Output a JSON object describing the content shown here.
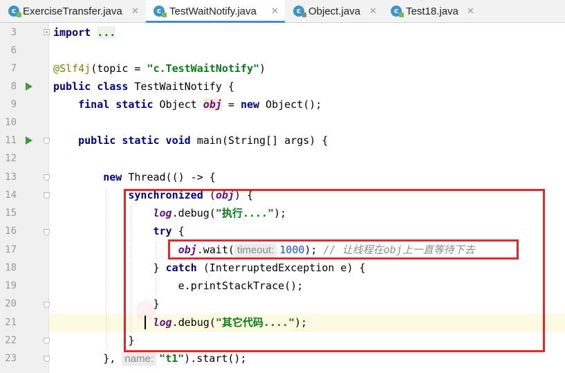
{
  "tabs": [
    {
      "label": "ExerciseTransfer.java",
      "icon": "java-class-icon",
      "active": false
    },
    {
      "label": "TestWaitNotify.java",
      "icon": "java-class-icon",
      "active": true
    },
    {
      "label": "Object.java",
      "icon": "java-library-class-icon",
      "active": false
    },
    {
      "label": "Test18.java",
      "icon": "java-class-icon",
      "active": false
    }
  ],
  "tab_close_glyph": "✕",
  "line_numbers": [
    "3",
    "6",
    "7",
    "8",
    "9",
    "10",
    "11",
    "12",
    "13",
    "14",
    "15",
    "16",
    "17",
    "18",
    "19",
    "20",
    "21",
    "22",
    "23"
  ],
  "code": {
    "l3_import": "import",
    "l3_dots": "...",
    "l7_annotation": "@Slf4j",
    "l7_open": "(topic = ",
    "l7_string": "\"c.TestWaitNotify\"",
    "l7_close": ")",
    "l8_keywords": "public class",
    "l8_rest": " TestWaitNotify {",
    "l9_keywords": "final static",
    "l9_type": " Object ",
    "l9_field": "obj",
    "l9_eq": " = ",
    "l9_new": "new",
    "l9_rest": " Object();",
    "l11_keywords": "public static void",
    "l11_rest": " main(String[] args) {",
    "l13_new": "new",
    "l13_rest": " Thread(() -> {",
    "l14_keyword": "synchronized",
    "l14_open": " (",
    "l14_field": "obj",
    "l14_close": ") {",
    "l15_log": "log",
    "l15_call": ".debug(",
    "l15_string": "\"执行....\"",
    "l15_close": ");",
    "l16_try": "try",
    "l16_brace": " {",
    "l17_field": "obj",
    "l17_call": ".wait(",
    "l17_hint": "timeout:",
    "l17_num": "1000",
    "l17_close": ");",
    "l17_comment": "// 让线程在obj上一直等待下去",
    "l18_open": "} ",
    "l18_catch": "catch",
    "l18_rest": " (InterruptedException e) {",
    "l19_text": "e.printStackTrace();",
    "l20_text": "}",
    "l21_log": "log",
    "l21_call": ".debug(",
    "l21_string": "\"其它代码....\"",
    "l21_close": ");",
    "l22_text": "}",
    "l23_open": "},",
    "l23_hint": "name:",
    "l23_string": "\"t1\"",
    "l23_rest": ").start();"
  },
  "colors": {
    "keyword": "#000080",
    "string": "#067d17",
    "annotation": "#808000",
    "field": "#660e7a",
    "comment": "#8c8c8c",
    "highlight_box": "#e8262a",
    "active_tab_underline": "#4a88c7"
  }
}
